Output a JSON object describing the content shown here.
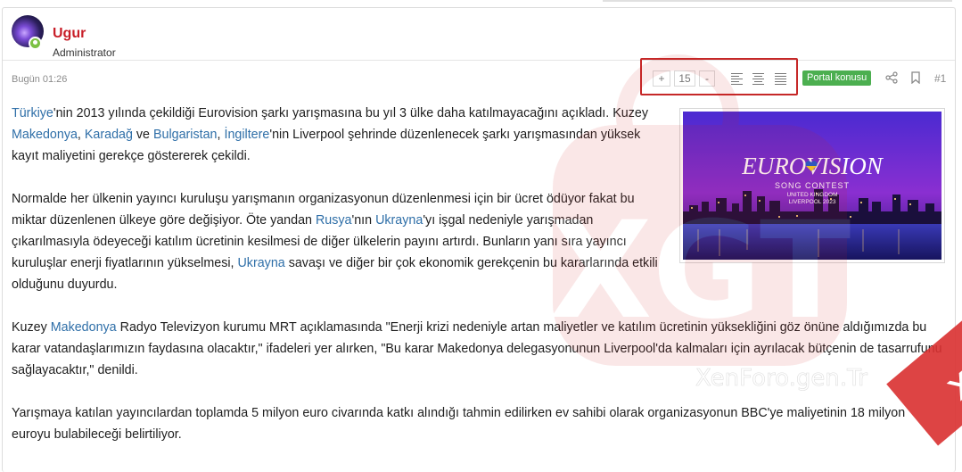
{
  "author": {
    "username": "Ugur",
    "title": "Administrator"
  },
  "post": {
    "date": "Bugün 01:26",
    "badge": "Portal konusu",
    "number": "#1",
    "font_size": "15",
    "font_increase": "+",
    "font_decrease": "-"
  },
  "image": {
    "logo_text": "EUROVISION",
    "subtitle": "SONG CONTEST",
    "line2": "UNITED KINGDOM",
    "line3": "LIVERPOOL 2023"
  },
  "paragraphs": {
    "p1": {
      "s1": "Türkiye",
      "s2": "'nin 2013 yılında çekildiği Eurovision şarkı yarışmasına bu yıl 3 ülke daha katılmayacağını açıkladı. Kuzey ",
      "s3": "Makedonya",
      "s4": ", ",
      "s5": "Karadağ",
      "s6": " ve ",
      "s7": "Bulgaristan",
      "s8": ", ",
      "s9": "İngiltere",
      "s10": "'nin Liverpool şehrinde düzenlenecek şarkı yarışmasından yüksek kayıt maliyetini gerekçe göstererek çekildi."
    },
    "p2": {
      "s1": "Normalde her ülkenin yayıncı kuruluşu yarışmanın organizasyonun düzenlenmesi için bir ücret ödüyor fakat bu miktar düzenlenen ülkeye göre değişiyor. Öte yandan ",
      "s2": "Rusya",
      "s3": "'nın ",
      "s4": "Ukrayna",
      "s5": "'yı işgal nedeniyle yarışmadan çıkarılmasıyla ödeyeceği katılım ücretinin kesilmesi de diğer ülkelerin payını artırdı. Bunların yanı sıra yayıncı kuruluşlar enerji fiyatlarının yükselmesi, ",
      "s6": "Ukrayna",
      "s7": " savaşı ve diğer bir çok ekonomik gerekçenin bu kararlarında etkili olduğunu duyurdu."
    },
    "p3": {
      "s1": "Kuzey ",
      "s2": "Makedonya",
      "s3": " Radyo Televizyon kurumu MRT açıklamasında \"Enerji krizi nedeniyle artan maliyetler ve katılım ücretinin yüksekliğini göz önüne aldığımızda bu karar vatandaşlarımızın faydasına olacaktır,\" ifadeleri yer alırken, \"Bu karar Makedonya delegasyonunun Liverpool'da kalmaları için ayrılacak bütçenin de tasarrufunu sağlayacaktır,\" denildi."
    },
    "p4": {
      "s1": "Yarışmaya katılan yayıncılardan toplamda 5 milyon euro civarında katkı alındığı tahmin edilirken ev sahibi olarak organizasyonun BBC'ye maliyetinin 18 milyon euroyu bulabileceği belirtiliyor."
    }
  },
  "watermark": {
    "brand": "xenforogen.tr",
    "site": "XenForo.gen.Tr",
    "logo": "XGT"
  },
  "colors": {
    "username": "#c81e28",
    "link": "#2f6fa8",
    "badge": "#4caf50",
    "highlight_box": "#c62828",
    "watermark_band": "#d93030"
  }
}
